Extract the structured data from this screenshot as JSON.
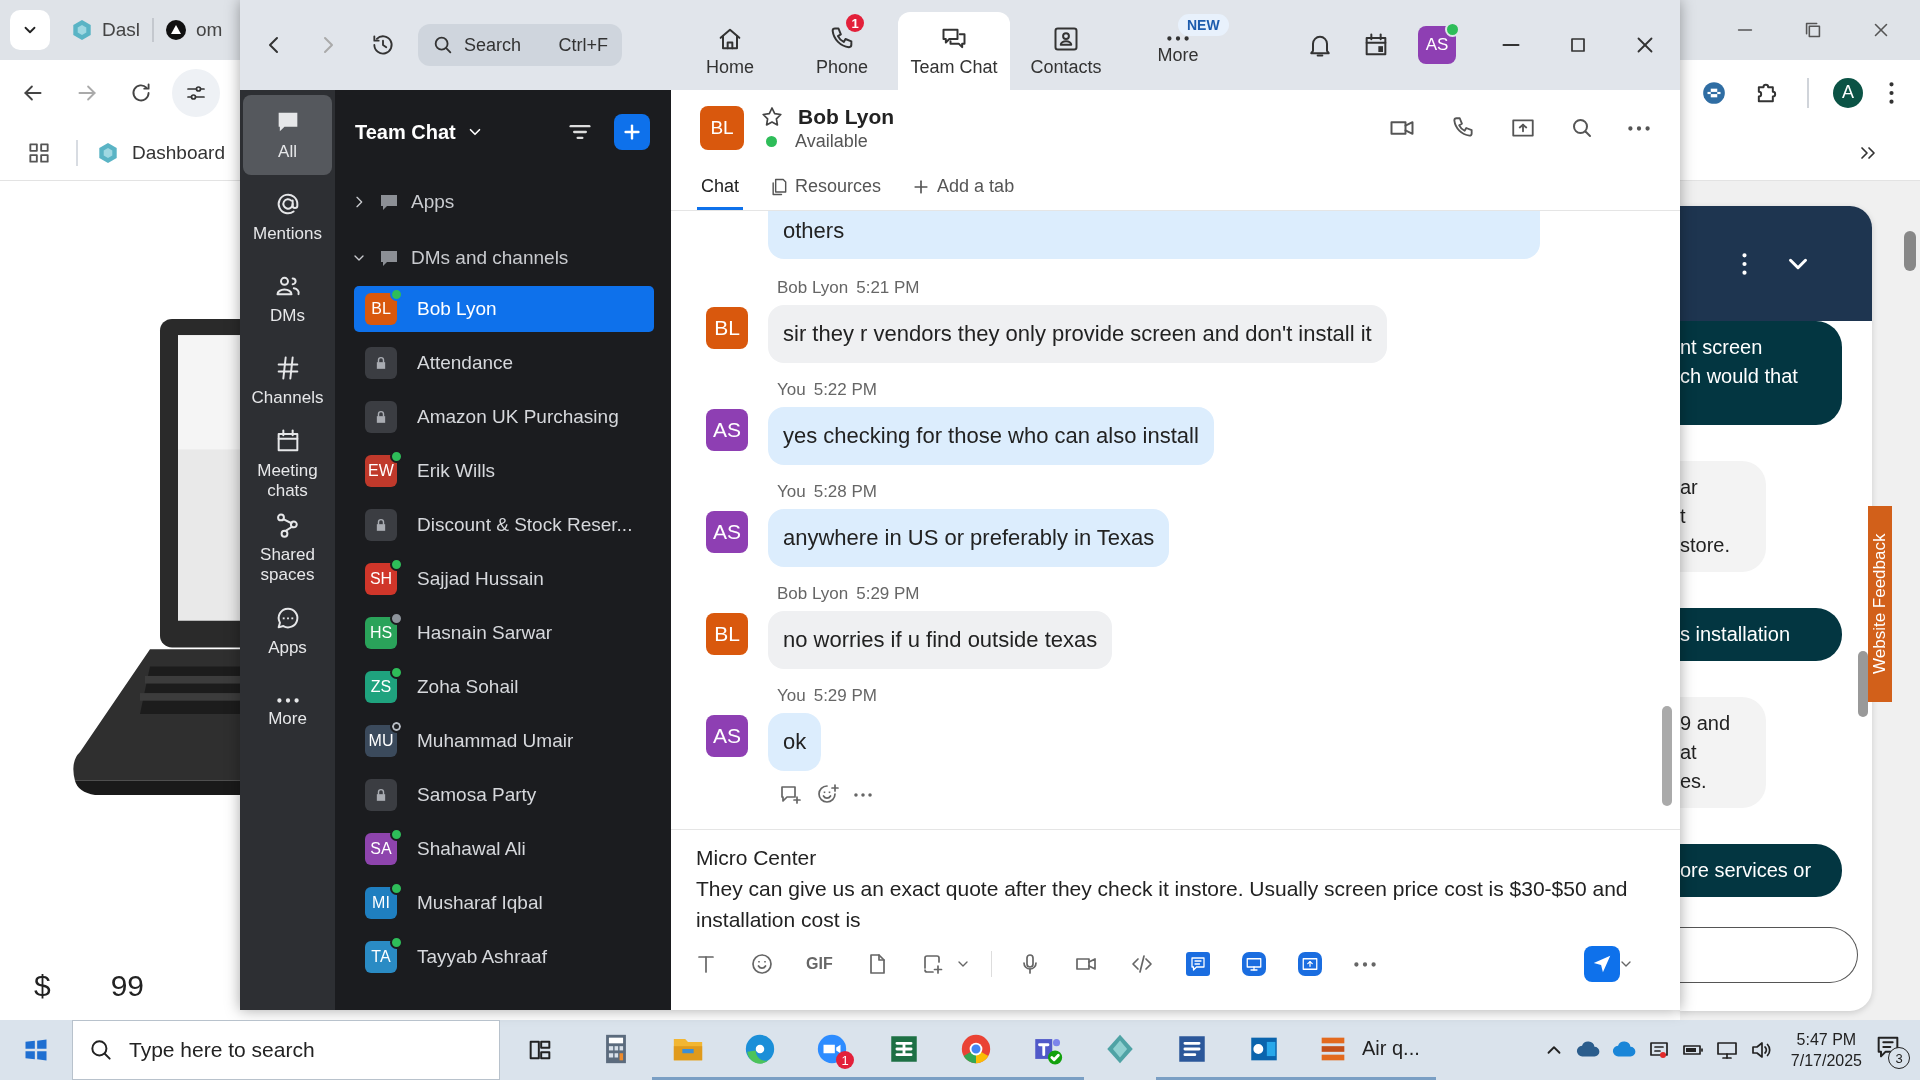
{
  "browser": {
    "tabs": [
      {
        "title": "Dasl"
      },
      {
        "title": "om"
      }
    ],
    "bookmarks": [
      {
        "title": "Dashboard"
      }
    ],
    "profile_initial": "A",
    "page": {
      "price_symbol": "$",
      "price_cents": "99",
      "feedback_tab": "Website Feedback",
      "widget_messages": [
        {
          "kind": "agent",
          "lines": [
            "nt screen",
            "ch would that"
          ]
        },
        {
          "kind": "visitor",
          "lines": [
            "ar",
            "t",
            "store."
          ]
        },
        {
          "kind": "agent",
          "lines": [
            "s installation"
          ]
        },
        {
          "kind": "visitor",
          "lines": [
            "9 and",
            "at",
            "es."
          ]
        },
        {
          "kind": "agent",
          "lines": [
            "ore services or"
          ]
        }
      ]
    }
  },
  "app": {
    "search": {
      "placeholder": "Search",
      "shortcut": "Ctrl+F"
    },
    "nav": [
      {
        "kind": "home",
        "label": "Home",
        "selected": false
      },
      {
        "kind": "phone",
        "label": "Phone",
        "badge": "1",
        "selected": false
      },
      {
        "kind": "chat",
        "label": "Team Chat",
        "selected": true
      },
      {
        "kind": "contacts",
        "label": "Contacts",
        "selected": false
      },
      {
        "kind": "more",
        "label": "More",
        "badge": "NEW",
        "selected": false
      }
    ],
    "user": {
      "initials": "AS",
      "online": true
    },
    "rail": [
      {
        "kind": "all",
        "label": "All",
        "selected": true
      },
      {
        "kind": "mentions",
        "label": "Mentions",
        "selected": false
      },
      {
        "kind": "dms",
        "label": "DMs",
        "selected": false
      },
      {
        "kind": "channels",
        "label": "Channels",
        "selected": false
      },
      {
        "kind": "meetings",
        "label": "Meeting chats",
        "selected": false
      },
      {
        "kind": "shared",
        "label": "Shared spaces",
        "selected": false
      },
      {
        "kind": "apps",
        "label": "Apps",
        "selected": false
      },
      {
        "kind": "more",
        "label": "More",
        "selected": false
      }
    ],
    "panel": {
      "title": "Team Chat",
      "sections": [
        {
          "label": "Apps",
          "expanded": false
        },
        {
          "label": "DMs and channels",
          "expanded": true
        }
      ],
      "conversations": [
        {
          "kind": "dm",
          "name": "Bob Lyon",
          "initials": "BL",
          "color": "#d9580d",
          "online": true,
          "away": false,
          "selected": true
        },
        {
          "kind": "channel",
          "name": "Attendance",
          "selected": false
        },
        {
          "kind": "channel",
          "name": "Amazon UK Purchasing",
          "selected": false
        },
        {
          "kind": "dm",
          "name": "Erik Wills",
          "initials": "EW",
          "color": "#c0392b",
          "online": true,
          "away": false,
          "selected": false
        },
        {
          "kind": "channel",
          "name": "Discount & Stock Reser...",
          "selected": false
        },
        {
          "kind": "dm",
          "name": "Sajjad Hussain",
          "initials": "SH",
          "color": "#d0362a",
          "online": true,
          "away": false,
          "selected": false
        },
        {
          "kind": "dm",
          "name": "Hasnain Sarwar",
          "initials": "HS",
          "color": "#2aa35a",
          "online": false,
          "away": true,
          "selected": false
        },
        {
          "kind": "dm",
          "name": "Zoha Sohail",
          "initials": "ZS",
          "color": "#1fa37e",
          "online": true,
          "away": false,
          "selected": false
        },
        {
          "kind": "dm",
          "name": "Muhammad Umair",
          "initials": "MU",
          "color": "#3b4a5c",
          "online": false,
          "away": false,
          "selected": false
        },
        {
          "kind": "channel",
          "name": "Samosa Party",
          "selected": false
        },
        {
          "kind": "dm",
          "name": "Shahawal Ali",
          "initials": "SA",
          "color": "#8e44ad",
          "online": true,
          "away": false,
          "selected": false
        },
        {
          "kind": "dm",
          "name": "Musharaf Iqbal",
          "initials": "MI",
          "color": "#1f7fc0",
          "online": true,
          "away": false,
          "selected": false
        },
        {
          "kind": "dm",
          "name": "Tayyab Ashraaf",
          "initials": "TA",
          "color": "#2a8bc4",
          "online": true,
          "away": false,
          "selected": false
        }
      ]
    },
    "chat": {
      "contact": {
        "initials": "BL",
        "color": "#d9580d",
        "name": "Bob Lyon",
        "status": "Available",
        "starred": false
      },
      "tabs": [
        {
          "kind": "chat",
          "label": "Chat",
          "selected": true
        },
        {
          "kind": "resources",
          "label": "Resources",
          "selected": false
        },
        {
          "kind": "add",
          "label": "Add a tab",
          "selected": false
        }
      ],
      "messages": [
        {
          "mine": true,
          "text": "others"
        },
        {
          "mine": false,
          "sender": "Bob Lyon",
          "time": "5:21 PM",
          "initials": "BL",
          "color": "#d9580d",
          "text": "sir they r vendors they only provide screen and don't install it"
        },
        {
          "mine": true,
          "sender": "You",
          "time": "5:22 PM",
          "initials": "AS",
          "color": "#8e3fb3",
          "text": "yes checking for those who can also install"
        },
        {
          "mine": true,
          "sender": "You",
          "time": "5:28 PM",
          "initials": "AS",
          "color": "#8e3fb3",
          "text": "anywhere in US or preferably in Texas"
        },
        {
          "mine": false,
          "sender": "Bob Lyon",
          "time": "5:29 PM",
          "initials": "BL",
          "color": "#d9580d",
          "text": "no worries if u find outside texas"
        },
        {
          "mine": true,
          "sender": "You",
          "time": "5:29 PM",
          "initials": "AS",
          "color": "#8e3fb3",
          "text": "ok"
        }
      ],
      "composer": {
        "value": "Micro Center\nThey can give us an exact quote after they check it instore. Usually screen price cost is $30-$50 and installation cost is",
        "gif_label": "GIF"
      }
    }
  },
  "taskbar": {
    "search_placeholder": "Type here to search",
    "apps": [
      {
        "kind": "calculator",
        "running": false
      },
      {
        "kind": "explorer",
        "running": true
      },
      {
        "kind": "edge",
        "running": true
      },
      {
        "kind": "zoom",
        "running": true,
        "badge": "1"
      },
      {
        "kind": "excel",
        "running": true
      },
      {
        "kind": "chrome",
        "running": true
      },
      {
        "kind": "teams",
        "running": true
      },
      {
        "kind": "diamond",
        "running": false
      },
      {
        "kind": "word",
        "running": true
      },
      {
        "kind": "outlook",
        "running": true
      },
      {
        "kind": "airq",
        "running": true,
        "label": "Air q..."
      }
    ],
    "time": "5:47 PM",
    "date": "7/17/2025",
    "notifications": "3"
  }
}
